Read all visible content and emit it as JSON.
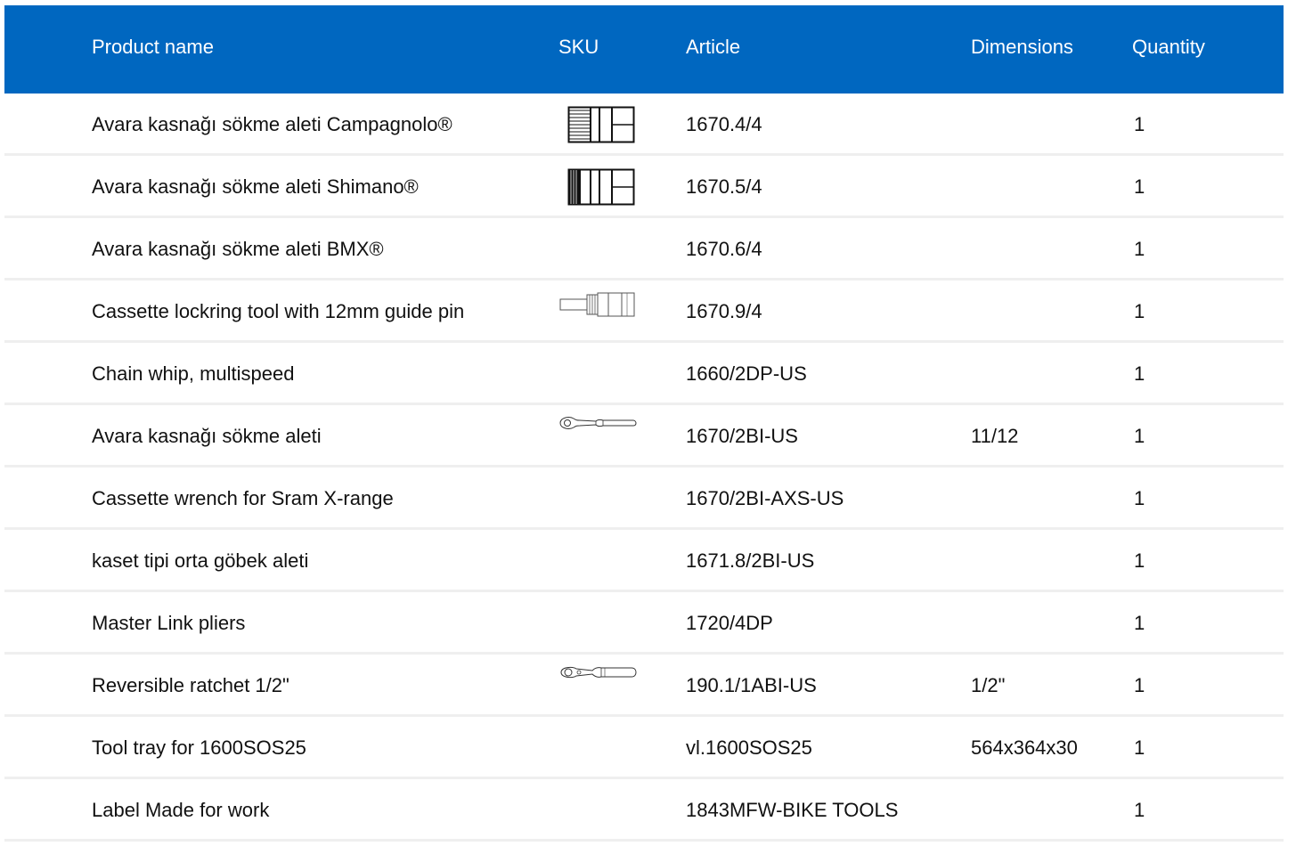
{
  "columns": {
    "name": "Product name",
    "sku": "SKU",
    "article": "Article",
    "dimensions": "Dimensions",
    "quantity": "Quantity"
  },
  "rows": [
    {
      "name": "Avara kasnağı sökme aleti Campagnolo®",
      "sku_icon": "campagnolo-lockring-tool-icon",
      "article": "1670.4/4",
      "dimensions": "",
      "quantity": "1"
    },
    {
      "name": "Avara kasnağı sökme aleti Shimano®",
      "sku_icon": "shimano-lockring-tool-icon",
      "article": "1670.5/4",
      "dimensions": "",
      "quantity": "1"
    },
    {
      "name": "Avara kasnağı sökme aleti BMX®",
      "sku_icon": "",
      "article": "1670.6/4",
      "dimensions": "",
      "quantity": "1"
    },
    {
      "name": "Cassette lockring tool with 12mm guide pin",
      "sku_icon": "guide-pin-tool-icon",
      "article": "1670.9/4",
      "dimensions": "",
      "quantity": "1"
    },
    {
      "name": "Chain whip, multispeed",
      "sku_icon": "",
      "article": "1660/2DP-US",
      "dimensions": "",
      "quantity": "1"
    },
    {
      "name": "Avara kasnağı sökme aleti",
      "sku_icon": "wrench-tool-icon",
      "article": "1670/2BI-US",
      "dimensions": "11/12",
      "quantity": "1"
    },
    {
      "name": "Cassette wrench for Sram X-range",
      "sku_icon": "",
      "article": "1670/2BI-AXS-US",
      "dimensions": "",
      "quantity": "1"
    },
    {
      "name": "kaset tipi orta göbek aleti",
      "sku_icon": "",
      "article": "1671.8/2BI-US",
      "dimensions": "",
      "quantity": "1"
    },
    {
      "name": "Master Link pliers",
      "sku_icon": "",
      "article": "1720/4DP",
      "dimensions": "",
      "quantity": "1"
    },
    {
      "name": "Reversible ratchet 1/2\"",
      "sku_icon": "ratchet-icon",
      "article": "190.1/1ABI-US",
      "dimensions": "1/2\"",
      "quantity": "1"
    },
    {
      "name": "Tool tray for 1600SOS25",
      "sku_icon": "",
      "article": "vl.1600SOS25",
      "dimensions": "564x364x30",
      "quantity": "1"
    },
    {
      "name": "Label Made for work",
      "sku_icon": "",
      "article": "1843MFW-BIKE TOOLS",
      "dimensions": "",
      "quantity": "1"
    }
  ],
  "colors": {
    "header_bg": "#0067c0",
    "header_text": "#ffffff",
    "row_divider": "#efefef"
  }
}
